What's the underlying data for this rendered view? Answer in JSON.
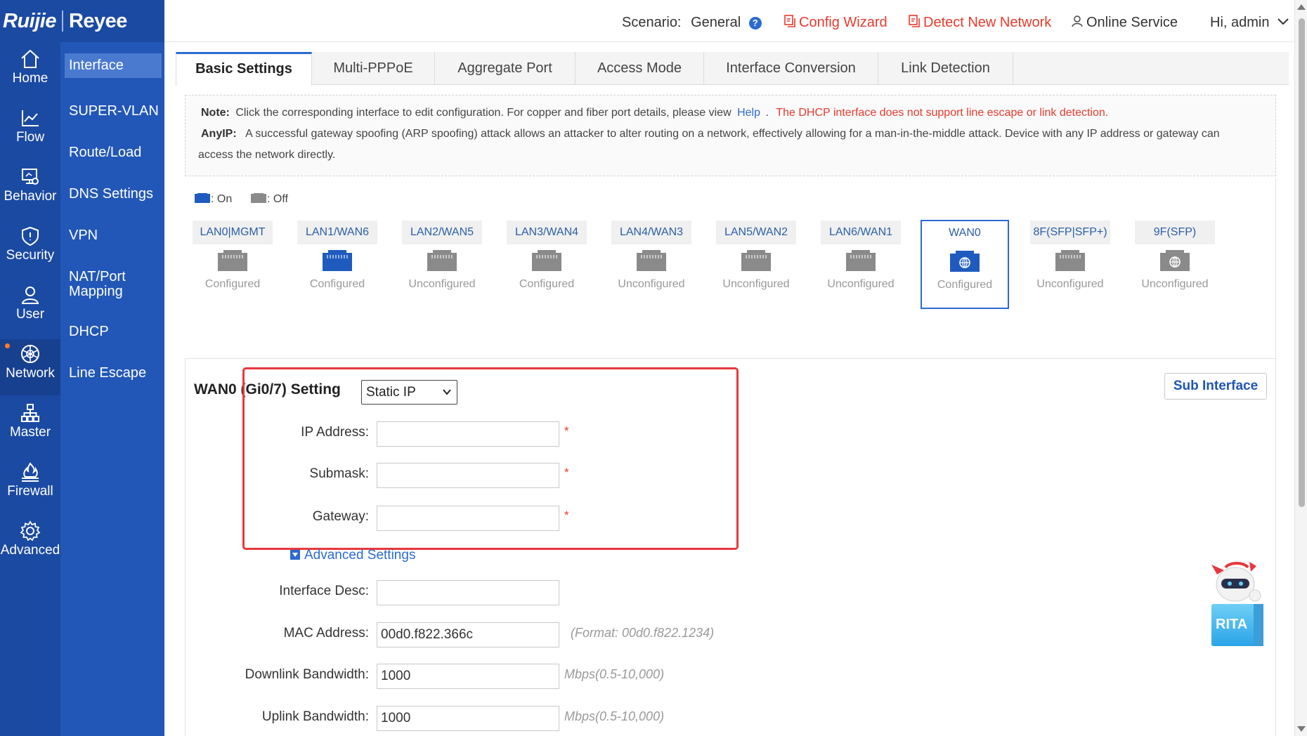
{
  "brand": {
    "logo_left": "Ruijie",
    "logo_right": "Reyee"
  },
  "header": {
    "scenario_label": "Scenario:",
    "scenario_value": "General",
    "config_wizard": "Config Wizard",
    "detect_network": "Detect New Network",
    "online_service": "Online Service",
    "greeting": "Hi, admin"
  },
  "nav_primary": [
    {
      "label": "Home",
      "icon": "home-icon"
    },
    {
      "label": "Flow",
      "icon": "flow-chart-icon"
    },
    {
      "label": "Behavior",
      "icon": "behavior-icon"
    },
    {
      "label": "Security",
      "icon": "shield-icon"
    },
    {
      "label": "User",
      "icon": "user-icon"
    },
    {
      "label": "Network",
      "icon": "globe-icon",
      "active": true
    },
    {
      "label": "Master",
      "icon": "topology-icon"
    },
    {
      "label": "Firewall",
      "icon": "firewall-icon"
    },
    {
      "label": "Advanced",
      "icon": "gear-icon"
    }
  ],
  "nav_secondary": [
    {
      "label": "Interface",
      "active": true
    },
    {
      "label": "SUPER-VLAN"
    },
    {
      "label": "Route/Load"
    },
    {
      "label": "DNS Settings"
    },
    {
      "label": "VPN"
    },
    {
      "label": "NAT/Port Mapping"
    },
    {
      "label": "DHCP"
    },
    {
      "label": "Line Escape"
    }
  ],
  "tabs": [
    {
      "label": "Basic Settings",
      "active": true
    },
    {
      "label": "Multi-PPPoE"
    },
    {
      "label": "Aggregate Port"
    },
    {
      "label": "Access Mode"
    },
    {
      "label": "Interface Conversion"
    },
    {
      "label": "Link Detection"
    }
  ],
  "note": {
    "note_label": "Note:",
    "note_text": "Click the corresponding interface to edit configuration. For copper and fiber port details, please view",
    "help_link": "Help",
    "note_dot": ".",
    "warning": "The DHCP interface does not support line escape or link detection.",
    "anyip_label": "AnyIP:",
    "anyip_text_1": "A successful gateway spoofing (ARP spoofing) attack allows an attacker to alter routing on a network, effectively allowing for a man-in-the-middle attack. Device with any IP address or gateway can",
    "anyip_text_2": "access the network directly."
  },
  "legend": {
    "on": ": On",
    "off": ": Off"
  },
  "ports": [
    {
      "label": "LAN0|MGMT",
      "status": "Configured",
      "state": "off",
      "kind": "copper"
    },
    {
      "label": "LAN1/WAN6",
      "status": "Configured",
      "state": "on",
      "kind": "copper"
    },
    {
      "label": "LAN2/WAN5",
      "status": "Unconfigured",
      "state": "off",
      "kind": "copper"
    },
    {
      "label": "LAN3/WAN4",
      "status": "Configured",
      "state": "off",
      "kind": "copper"
    },
    {
      "label": "LAN4/WAN3",
      "status": "Unconfigured",
      "state": "off",
      "kind": "copper"
    },
    {
      "label": "LAN5/WAN2",
      "status": "Unconfigured",
      "state": "off",
      "kind": "copper"
    },
    {
      "label": "LAN6/WAN1",
      "status": "Unconfigured",
      "state": "off",
      "kind": "copper"
    },
    {
      "label": "WAN0",
      "status": "Configured",
      "state": "on",
      "kind": "wan",
      "selected": true
    },
    {
      "label": "8F(SFP|SFP+)",
      "status": "Unconfigured",
      "state": "off",
      "kind": "copper"
    },
    {
      "label": "9F(SFP)",
      "status": "Unconfigured",
      "state": "off",
      "kind": "wan"
    }
  ],
  "setting": {
    "title": "WAN0 (Gi0/7) Setting",
    "mode": "Static IP",
    "sub_interface": "Sub Interface",
    "ip_label": "IP Address:",
    "ip_value": "",
    "mask_label": "Submask:",
    "mask_value": "",
    "gw_label": "Gateway:",
    "gw_value": "",
    "required_mark": "*",
    "advanced": "Advanced Settings",
    "desc_label": "Interface Desc:",
    "desc_value": "",
    "mac_label": "MAC Address:",
    "mac_value": "00d0.f822.366c",
    "mac_hint": "(Format: 00d0.f822.1234)",
    "down_label": "Downlink Bandwidth:",
    "down_value": "1000",
    "down_hint": "Mbps(0.5-10,000)",
    "up_label": "Uplink Bandwidth:",
    "up_value": "1000",
    "up_hint": "Mbps(0.5-10,000)"
  },
  "assistant": {
    "label": "RITA"
  },
  "colors": {
    "nav_primary": "#1b4aa3",
    "nav_secondary": "#2257b7",
    "accent": "#2b6bd1",
    "warning": "#e83a2b",
    "port_on": "#1f5bbf",
    "port_off": "#8a8a8a"
  }
}
